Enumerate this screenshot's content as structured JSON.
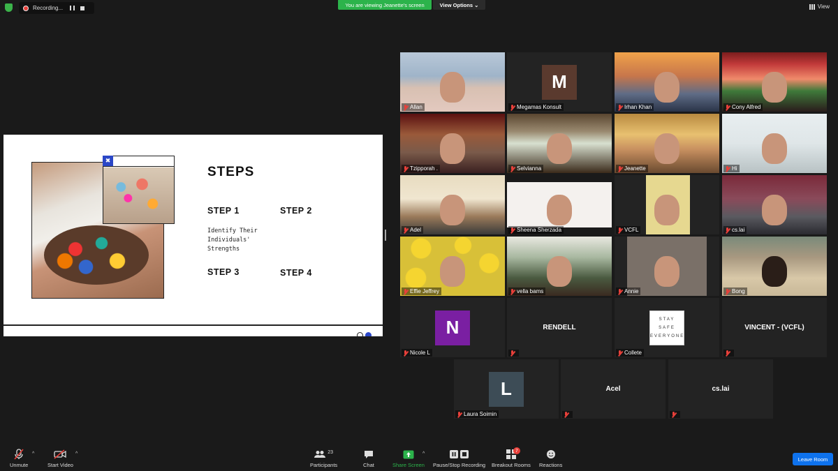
{
  "topbar": {
    "recording_label": "Recording...",
    "viewing_banner": "You are viewing Jeanette's screen",
    "view_options": "View Options",
    "view_label": "View"
  },
  "slide": {
    "title": "STEPS",
    "steps": [
      "STEP 1",
      "STEP 2",
      "STEP 3",
      "STEP 4"
    ],
    "step1_desc": "Identify Their Individuals' Strengths"
  },
  "participants": [
    {
      "name": "Allan",
      "type": "video"
    },
    {
      "name": "Megamas Konsult",
      "type": "avatar",
      "initial": "M",
      "color": "#5a3a2e"
    },
    {
      "name": "Irhan Khan",
      "type": "video"
    },
    {
      "name": "Cony Alfred",
      "type": "video"
    },
    {
      "name": "Tzipporah .",
      "type": "video"
    },
    {
      "name": "Selvianna",
      "type": "video"
    },
    {
      "name": "Jeanette",
      "type": "video",
      "active": true
    },
    {
      "name": "Hi",
      "type": "video"
    },
    {
      "name": "Adel",
      "type": "video"
    },
    {
      "name": "Sheena Sherzada",
      "type": "video"
    },
    {
      "name": "VCFL",
      "type": "video"
    },
    {
      "name": "cs.lai",
      "type": "video"
    },
    {
      "name": "Effie Jeffrey",
      "type": "video"
    },
    {
      "name": "vella bams",
      "type": "video"
    },
    {
      "name": "Annie",
      "type": "video"
    },
    {
      "name": "Bong",
      "type": "video"
    },
    {
      "name": "Nicole L",
      "type": "avatar",
      "initial": "N",
      "color": "#7a1fa2"
    },
    {
      "name": "",
      "type": "text",
      "label": "RENDELL"
    },
    {
      "name": "Collete",
      "type": "stay",
      "stay_lines": [
        "STAY",
        "SAFE",
        "EVERYONE"
      ]
    },
    {
      "name": "",
      "type": "text",
      "label": "VINCENT - (VCFL)"
    },
    {
      "name": "Laura Soimin",
      "type": "avatar",
      "initial": "L",
      "color": "#3d4c56"
    },
    {
      "name": "",
      "type": "text",
      "label": "Acel"
    },
    {
      "name": "",
      "type": "text",
      "label": "cs.lai"
    }
  ],
  "toolbar": {
    "unmute": "Unmute",
    "start_video": "Start Video",
    "participants": "Participants",
    "participants_count": "23",
    "chat": "Chat",
    "share_screen": "Share Screen",
    "pause_recording": "Pause/Stop Recording",
    "breakout_rooms": "Breakout Rooms",
    "breakout_badge": "7",
    "reactions": "Reactions",
    "leave_room": "Leave Room"
  },
  "colors": {
    "accent_green": "#2cb34b",
    "leave_blue": "#0e72ed",
    "active_speaker": "#e8d54a",
    "muted_red": "#e8403a"
  }
}
